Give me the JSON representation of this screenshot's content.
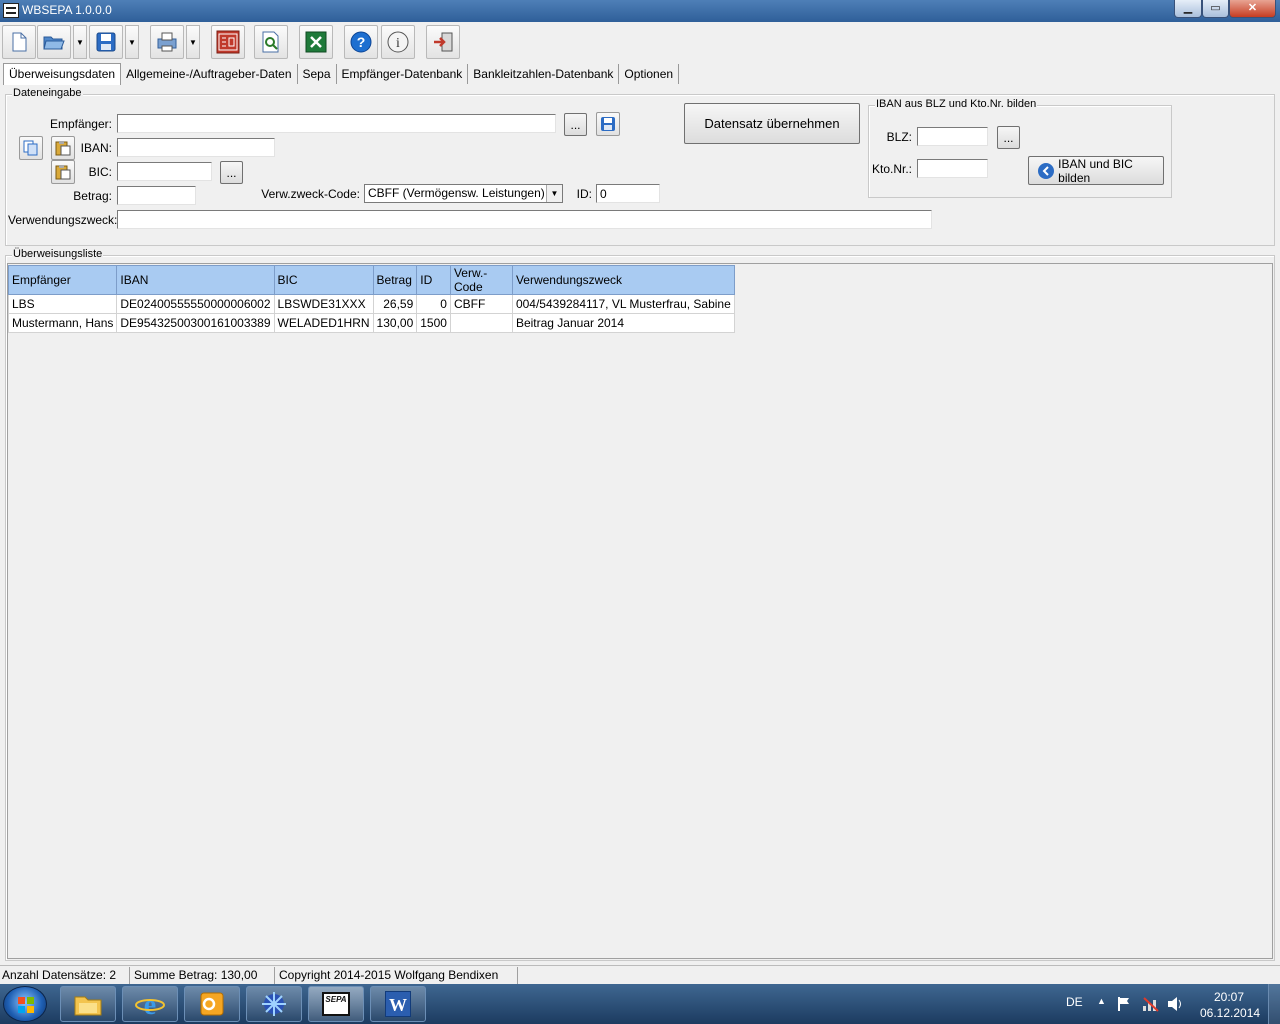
{
  "window": {
    "title": "WBSEPA 1.0.0.0",
    "min_icon": "minimize-icon",
    "max_icon": "maximize-icon",
    "close_icon": "close-icon",
    "min": "▁",
    "max": "▭",
    "close": "✕"
  },
  "toolbar": {
    "icons": [
      "new-document-icon",
      "open-folder-icon",
      "save-icon",
      "print-icon",
      "sepa-export-icon",
      "preview-icon",
      "excel-icon",
      "help-icon",
      "info-icon",
      "exit-icon"
    ]
  },
  "tabs": [
    "Überweisungsdaten",
    "Allgemeine-/Auftrageber-Daten",
    "Sepa",
    "Empfänger-Datenbank",
    "Bankleitzahlen-Datenbank",
    "Optionen"
  ],
  "entry": {
    "legend": "Dateneingabe",
    "empfaenger_label": "Empfänger:",
    "empfaenger_value": "",
    "iban_label": "IBAN:",
    "iban_value": "",
    "bic_label": "BIC:",
    "bic_value": "",
    "betrag_label": "Betrag:",
    "betrag_value": "",
    "code_label": "Verw.zweck-Code:",
    "code_value": "CBFF (Vermögensw. Leistungen)",
    "id_label": "ID:",
    "id_value": "0",
    "zweck_label": "Verwendungszweck:",
    "zweck_value": "",
    "browse": "...",
    "submit": "Datensatz übernehmen"
  },
  "iban_builder": {
    "legend": "IBAN aus BLZ und Kto.Nr. bilden",
    "blz_label": "BLZ:",
    "blz_value": "",
    "kto_label": "Kto.Nr.:",
    "kto_value": "",
    "browse": "...",
    "build_button": "IBAN und BIC bilden"
  },
  "list": {
    "legend": "Überweisungsliste",
    "columns": [
      "Empfänger",
      "IBAN",
      "BIC",
      "Betrag",
      "ID",
      "Verw.-Code",
      "Verwendungszweck"
    ],
    "rows": [
      [
        "LBS",
        "DE02400555550000006002",
        "LBSWDE31XXX",
        "26,59",
        "0",
        "CBFF",
        "004/5439284117, VL Musterfrau, Sabine"
      ],
      [
        "Mustermann, Hans",
        "DE95432500300161003389",
        "WELADED1HRN",
        "130,00",
        "1500",
        "",
        "Beitrag Januar 2014"
      ]
    ]
  },
  "status": {
    "count": "Anzahl Datensätze: 2",
    "sum": "Summe Betrag: 130,00",
    "copyright": "Copyright 2014-2015 Wolfgang Bendixen"
  },
  "taskbar": {
    "apps": [
      "explorer-icon",
      "internet-explorer-icon",
      "outlook-icon",
      "app-icon",
      "wbsepa-icon",
      "word-icon"
    ],
    "sepa_text": "SEPA",
    "word_text": "W",
    "lang": "DE",
    "time": "20:07",
    "date": "06.12.2014"
  }
}
